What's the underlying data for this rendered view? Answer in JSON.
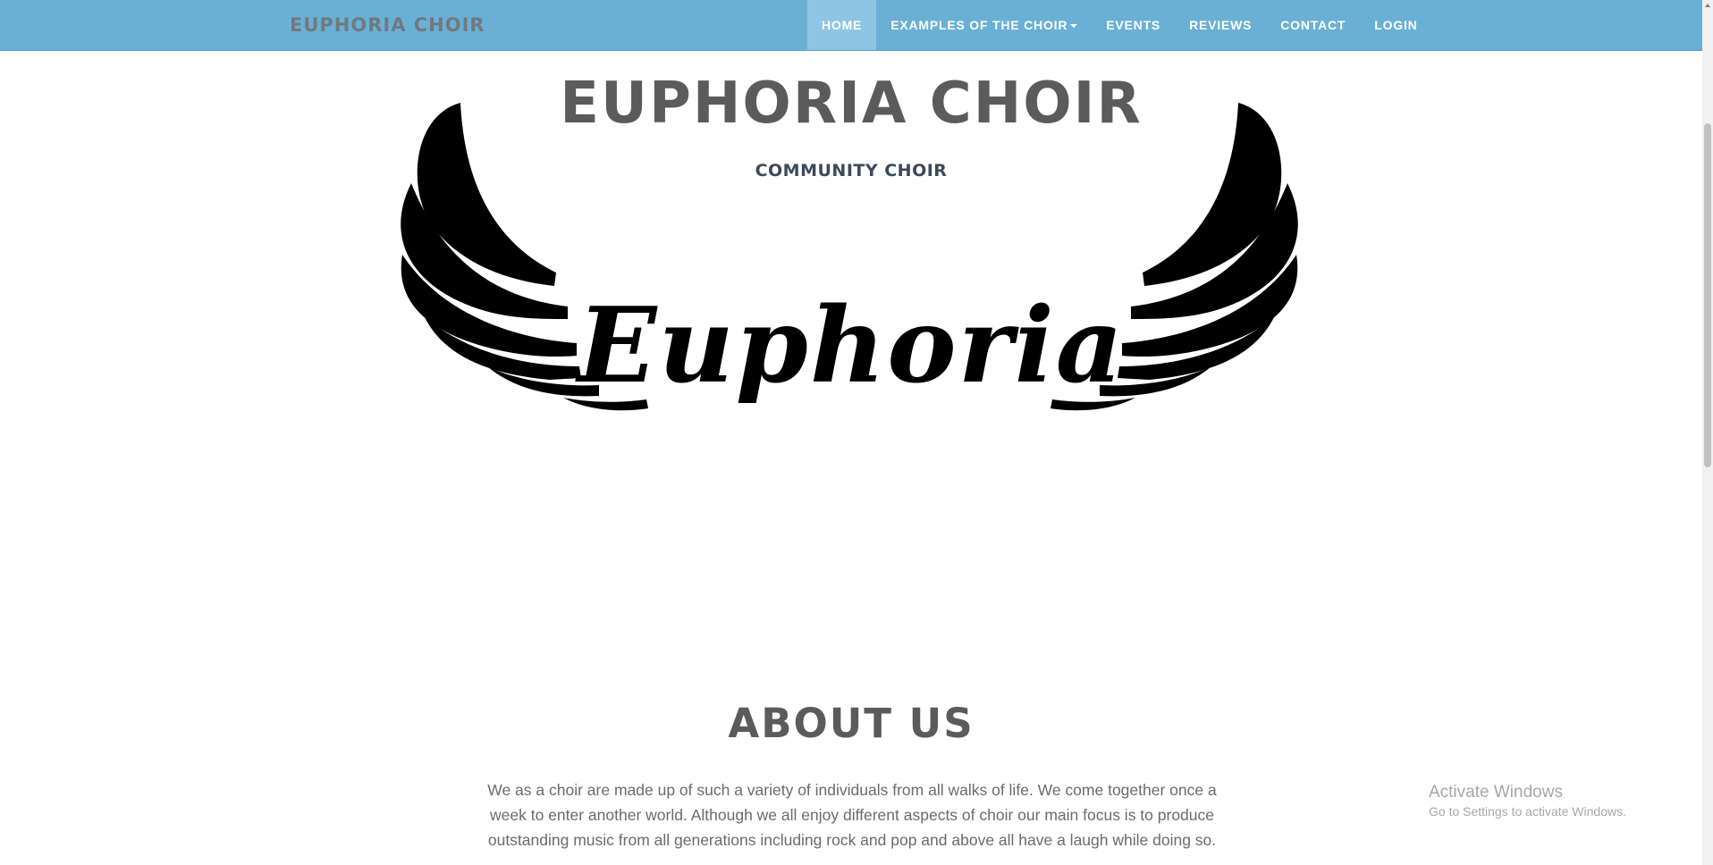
{
  "navbar": {
    "brand": "EUPHORIA CHOIR",
    "items": [
      {
        "label": "HOME"
      },
      {
        "label": "EXAMPLES OF THE CHOIR"
      },
      {
        "label": "EVENTS"
      },
      {
        "label": "REVIEWS"
      },
      {
        "label": "CONTACT"
      },
      {
        "label": "LOGIN"
      }
    ],
    "colors": {
      "background": "#6ab0d5",
      "active": "#8fc5e2",
      "text": "#ffffff",
      "brand": "#6f7a80"
    }
  },
  "hero": {
    "title": "EUPHORIA CHOIR",
    "subtitle": "COMMUNITY CHOIR",
    "logo_text": "Euphoria"
  },
  "about": {
    "title": "ABOUT US",
    "text": "We as a choir are made up of such a variety of individuals from all walks of life. We come together once a week to enter another world. Although we all enjoy different aspects of choir our main focus is to produce outstanding music from all generations including rock and pop and above all have a laugh while doing so."
  },
  "watermark": {
    "line1": "Activate Windows",
    "line2": "Go to Settings to activate Windows."
  }
}
